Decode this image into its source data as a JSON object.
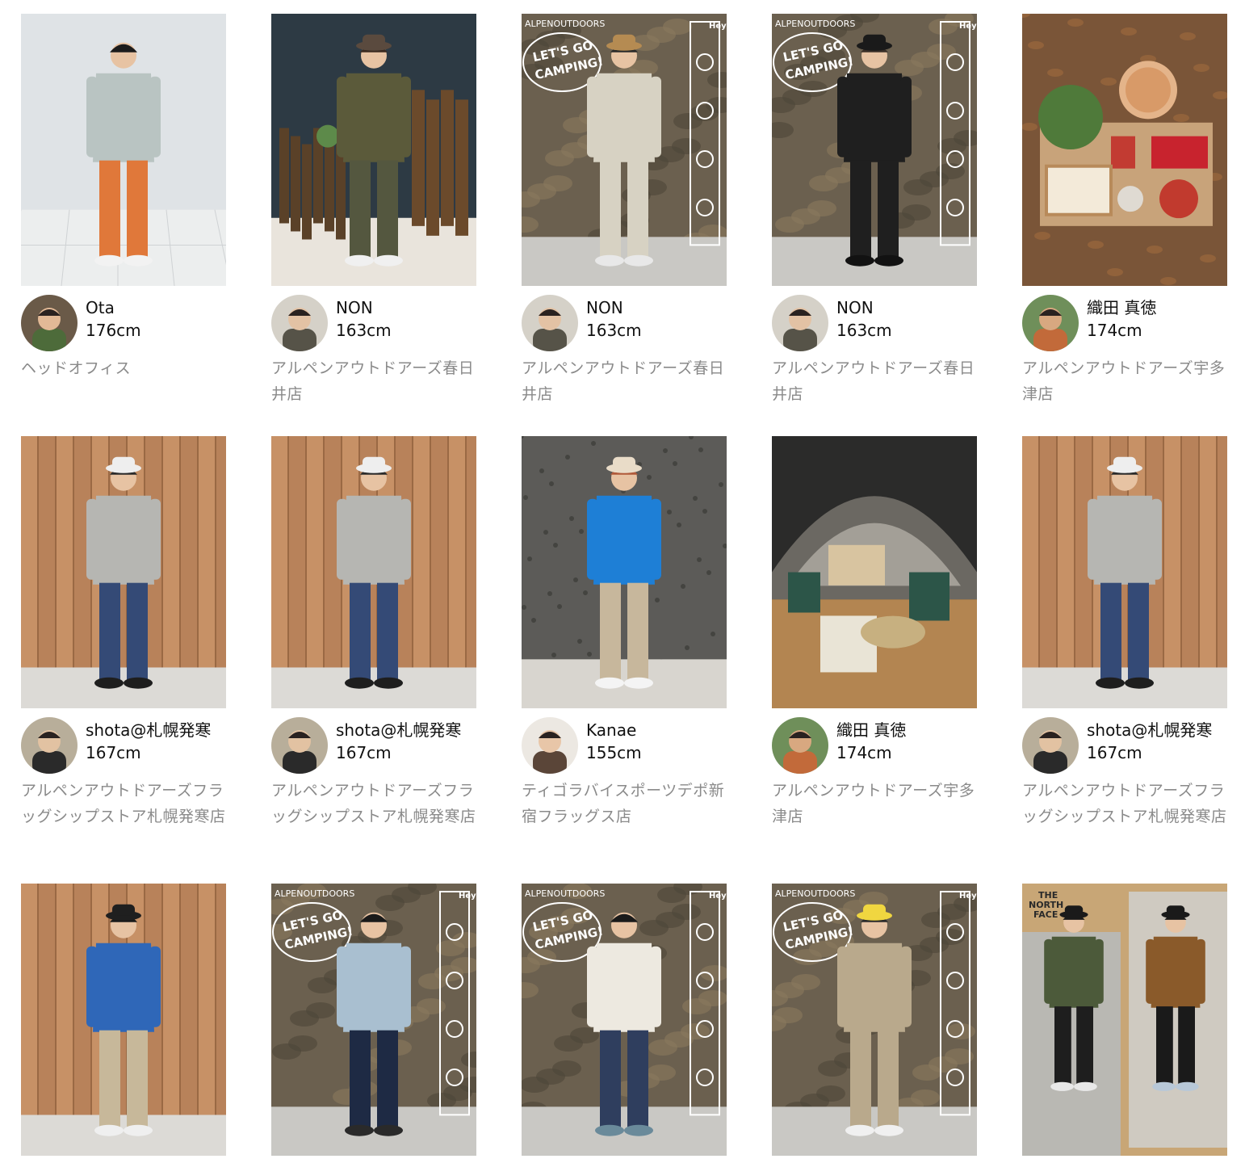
{
  "colors": {
    "name_text": "#111111",
    "store_text": "#8a8a8a",
    "background": "#ffffff"
  },
  "rows": [
    {
      "cards": [
        {
          "name": "Ota",
          "height": "176cm",
          "store": "ヘッドオフィス",
          "photo_icon": "person-icon",
          "scene": "white-studio"
        },
        {
          "name": "NON",
          "height": "163cm",
          "store": "アルペンアウトドアーズ春日井店",
          "photo_icon": "person-icon",
          "scene": "dark-display"
        },
        {
          "name": "NON",
          "height": "163cm",
          "store": "アルペンアウトドアーズ春日井店",
          "photo_icon": "person-icon",
          "scene": "camping-mural"
        },
        {
          "name": "NON",
          "height": "163cm",
          "store": "アルペンアウトドアーズ春日井店",
          "photo_icon": "person-icon",
          "scene": "camping-mural"
        },
        {
          "name": "織田 真徳",
          "height": "174cm",
          "store": "アルペンアウトドアーズ宇多津店",
          "photo_icon": "food-icon",
          "scene": "food-flatlay"
        }
      ]
    },
    {
      "cards": [
        {
          "name": "shota@札幌発寒",
          "height": "167cm",
          "store": "アルペンアウトドアーズフラッグシップストア札幌発寒店",
          "photo_icon": "person-icon",
          "scene": "wood-wall"
        },
        {
          "name": "shota@札幌発寒",
          "height": "167cm",
          "store": "アルペンアウトドアーズフラッグシップストア札幌発寒店",
          "photo_icon": "person-icon",
          "scene": "wood-wall"
        },
        {
          "name": "Kanae",
          "height": "155cm",
          "store": "ティゴラバイスポーツデポ新宿フラッグス店",
          "photo_icon": "person-icon",
          "scene": "stone-wall"
        },
        {
          "name": "織田 真徳",
          "height": "174cm",
          "store": "アルペンアウトドアーズ宇多津店",
          "photo_icon": "tent-icon",
          "scene": "tent-display"
        },
        {
          "name": "shota@札幌発寒",
          "height": "167cm",
          "store": "アルペンアウトドアーズフラッグシップストア札幌発寒店",
          "photo_icon": "person-icon",
          "scene": "wood-wall"
        }
      ]
    },
    {
      "cards": [
        {
          "photo_icon": "person-icon",
          "scene": "wood-wall"
        },
        {
          "photo_icon": "person-icon",
          "scene": "camping-mural"
        },
        {
          "photo_icon": "person-icon",
          "scene": "camping-mural"
        },
        {
          "photo_icon": "person-icon",
          "scene": "camping-mural"
        },
        {
          "photo_icon": "person-icon",
          "scene": "north-face-collage"
        }
      ]
    }
  ],
  "photo_texts": {
    "mural_slogan_1": "LET'S GO",
    "mural_slogan_2": "CAMPING!",
    "mural_brand": "ALPENOUTDOORS",
    "mural_hey": "Hey!",
    "north_face_1": "THE",
    "north_face_2": "NORTH",
    "north_face_3": "FACE"
  }
}
